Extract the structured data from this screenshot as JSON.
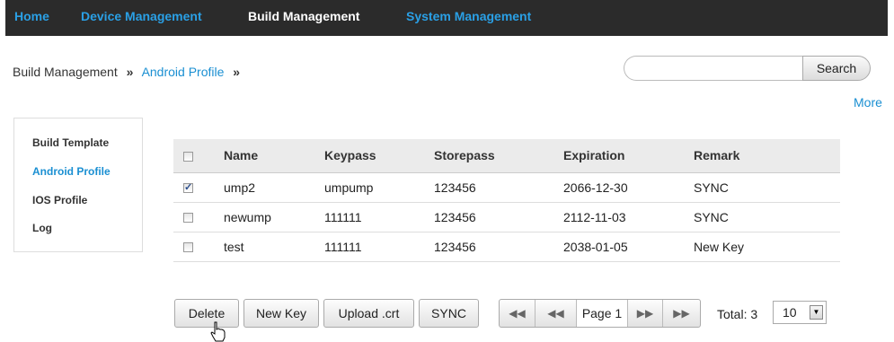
{
  "nav": {
    "home": "Home",
    "device": "Device Management",
    "build": "Build Management",
    "system": "System Management"
  },
  "breadcrumb": {
    "root": "Build Management",
    "sep": "»",
    "current": "Android Profile"
  },
  "search": {
    "placeholder": "",
    "button": "Search"
  },
  "more": "More",
  "sidebar": {
    "items": [
      {
        "label": "Build Template"
      },
      {
        "label": "Android Profile"
      },
      {
        "label": "IOS Profile"
      },
      {
        "label": "Log"
      }
    ]
  },
  "table": {
    "headers": {
      "name": "Name",
      "keypass": "Keypass",
      "storepass": "Storepass",
      "expiration": "Expiration",
      "remark": "Remark"
    },
    "rows": [
      {
        "name": "ump2",
        "keypass": "umpump",
        "storepass": "123456",
        "expiration": "2066-12-30",
        "remark": "SYNC",
        "checked": true
      },
      {
        "name": "newump",
        "keypass": "111111",
        "storepass": "123456",
        "expiration": "2112-11-03",
        "remark": "SYNC",
        "checked": false
      },
      {
        "name": "test",
        "keypass": "111111",
        "storepass": "123456",
        "expiration": "2038-01-05",
        "remark": "New Key",
        "checked": false
      }
    ]
  },
  "actions": {
    "delete": "Delete",
    "new_key": "New Key",
    "upload": "Upload .crt",
    "sync": "SYNC"
  },
  "pager": {
    "page": "Page 1",
    "total": "Total: 3",
    "page_size": "10"
  }
}
